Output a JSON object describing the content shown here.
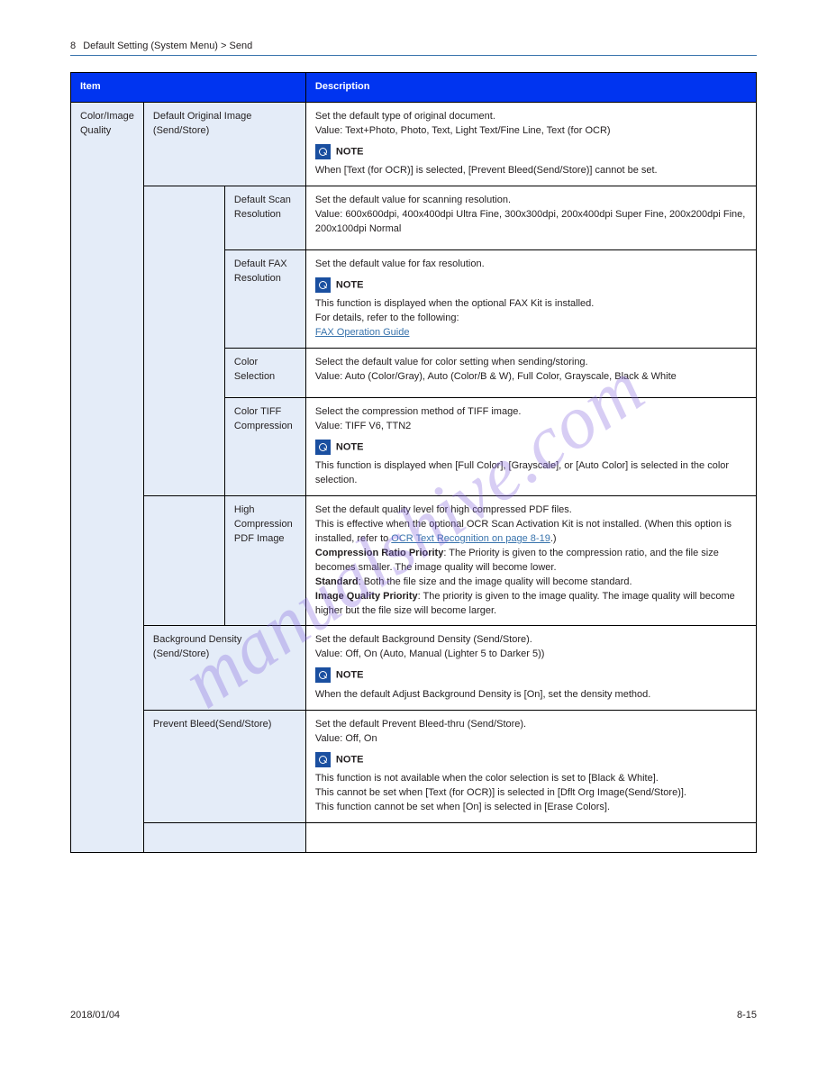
{
  "breadcrumb": {
    "chapter_no": "8",
    "chapter": "Default Setting (System Menu)",
    "sep": ">",
    "section": "Send"
  },
  "header": {
    "item": "Item",
    "desc": "Description"
  },
  "root": {
    "title": "Color/Image Quality"
  },
  "r1": {
    "title": "Default Original Image (Send/Store)",
    "body": "Set the default type of original document.",
    "value": "Value: Text+Photo, Photo, Text, Light Text/Fine Line, Text (for OCR)",
    "note_lbl": "NOTE",
    "note": "When [Text (for OCR)] is selected, [Prevent Bleed(Send/Store)] cannot be set."
  },
  "r2": {
    "title": "Default Scan Resolution",
    "body": "Set the default value for scanning resolution.",
    "value": "Value: 600x600dpi, 400x400dpi Ultra Fine, 300x300dpi, 200x400dpi Super Fine, 200x200dpi Fine, 200x100dpi Normal"
  },
  "r3": {
    "title": "Default FAX Resolution",
    "body": "Set the default value for fax resolution.",
    "note_lbl": "NOTE",
    "note_a": "This function is displayed when the optional FAX Kit is installed.",
    "note_b": "For details, refer to the following:",
    "link": "FAX Operation Guide"
  },
  "r4": {
    "title": "Color Selection",
    "body": "Select the default value for color setting when sending/storing.",
    "value": "Value: Auto (Color/Gray), Auto (Color/B & W), Full Color, Grayscale, Black & White"
  },
  "r5": {
    "title": "Color TIFF Compression",
    "body": "Select the compression method of TIFF image.",
    "value": "Value: TIFF V6, TTN2",
    "note_lbl": "NOTE",
    "note": "This function is displayed when [Full Color], [Grayscale], or [Auto Color] is selected in the color selection."
  },
  "r6": {
    "title": "High Compression PDF Image",
    "body_a": "Set the default quality level for high compressed PDF files.",
    "body_b_pre": "This is effective when the optional OCR Scan Activation Kit is not installed. (When this option is installed, refer to ",
    "link": "OCR Text Recognition on page 8-19",
    "body_b_post": ".)",
    "val1_lbl": "Compression Ratio Priority",
    "val1_txt": ": The Priority is given to the compression ratio, and the file size becomes smaller. The image quality will become lower.",
    "val2_lbl": "Standard",
    "val2_txt": ": Both the file size and the image quality will become standard.",
    "val3_lbl": "Image Quality Priority",
    "val3_txt": ": The priority is given to the image quality. The image quality will become higher but the file size will become larger."
  },
  "r7": {
    "title": "Background Density (Send/Store)",
    "body": "Set the default Background Density (Send/Store).",
    "value": "Value: Off, On (Auto, Manual (Lighter 5 to Darker 5))",
    "note_lbl": "NOTE",
    "note": "When the default Adjust Background Density is [On], set the density method."
  },
  "r8": {
    "title": "Prevent Bleed(Send/Store)",
    "body": "Set the default Prevent Bleed-thru (Send/Store).",
    "value": "Value: Off, On",
    "note_lbl": "NOTE",
    "note_a": "This function is not available when the color selection is set to [Black & White].",
    "note_b": "This cannot be set when [Text (for OCR)] is selected in [Dflt Org Image(Send/Store)].",
    "note_c": "This function cannot be set when [On] is selected in [Erase Colors]."
  },
  "footer": {
    "left": "2018/01/04",
    "right": "8-15"
  },
  "watermark": "manualshive.com"
}
